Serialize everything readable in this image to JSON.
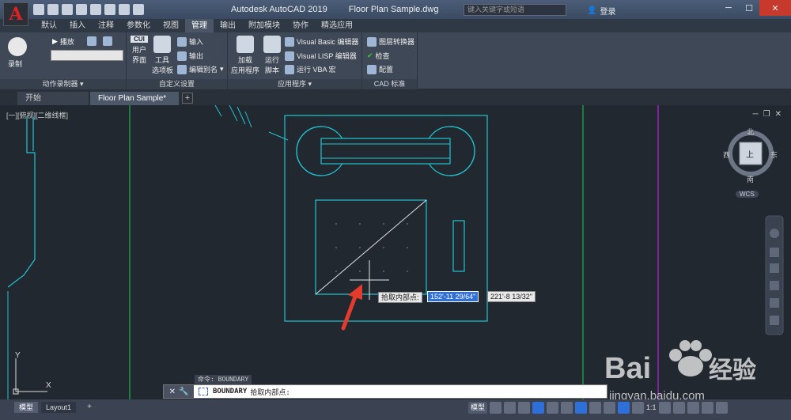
{
  "titlebar": {
    "app_name": "Autodesk AutoCAD 2019",
    "file_name": "Floor Plan Sample.dwg",
    "search_placeholder": "键入关键字或短语",
    "login": "登录",
    "app_button": "A"
  },
  "menu_tabs": [
    "默认",
    "插入",
    "注释",
    "参数化",
    "视图",
    "管理",
    "输出",
    "附加模块",
    "协作",
    "精选应用"
  ],
  "ribbon": {
    "record_label": "录制",
    "play_label": "播放",
    "action_recorder_title": "动作录制器",
    "cui_badge": "CUI",
    "user_interface": [
      "用户",
      "界面"
    ],
    "tool_palettes": [
      "工具",
      "选项板"
    ],
    "import_label": "输入",
    "export_label": "输出",
    "edit_alias": "编辑别名",
    "customize_title": "自定义设置",
    "load_app": [
      "加载",
      "应用程序"
    ],
    "run_script": [
      "运行",
      "脚本"
    ],
    "vb_editor": "Visual Basic 编辑器",
    "lisp_editor": "Visual LISP 编辑器",
    "run_vba": "运行 VBA 宏",
    "applications_title": "应用程序",
    "layer_translator": "图层转换器",
    "check": "检查",
    "configure": "配置",
    "cad_standards_title": "CAD 标准"
  },
  "doc_tabs": [
    "开始",
    "Floor Plan Sample*"
  ],
  "viewport": {
    "label": "[一][俯视][二维线框]",
    "compass": {
      "north": "北",
      "south": "南",
      "east": "东",
      "west": "西",
      "top": "上",
      "ucs": "WCS"
    },
    "axis_x": "X",
    "axis_y": "Y"
  },
  "prompt_tip": {
    "label": "拾取内部点:",
    "x_value": "152'-11 29/64\"",
    "y_value": "221'-8 13/32\""
  },
  "command": {
    "history": "命令: BOUNDARY",
    "current_cmd": "BOUNDARY",
    "current_prompt": "拾取内部点:"
  },
  "status": {
    "tabs": [
      "模型",
      "Layout1"
    ],
    "model_label": "模型",
    "scale": "1:1"
  },
  "colors": {
    "cyan": "#22c4d0",
    "green": "#1db34a",
    "magenta": "#a020c0",
    "arrow": "#e53b2c"
  }
}
